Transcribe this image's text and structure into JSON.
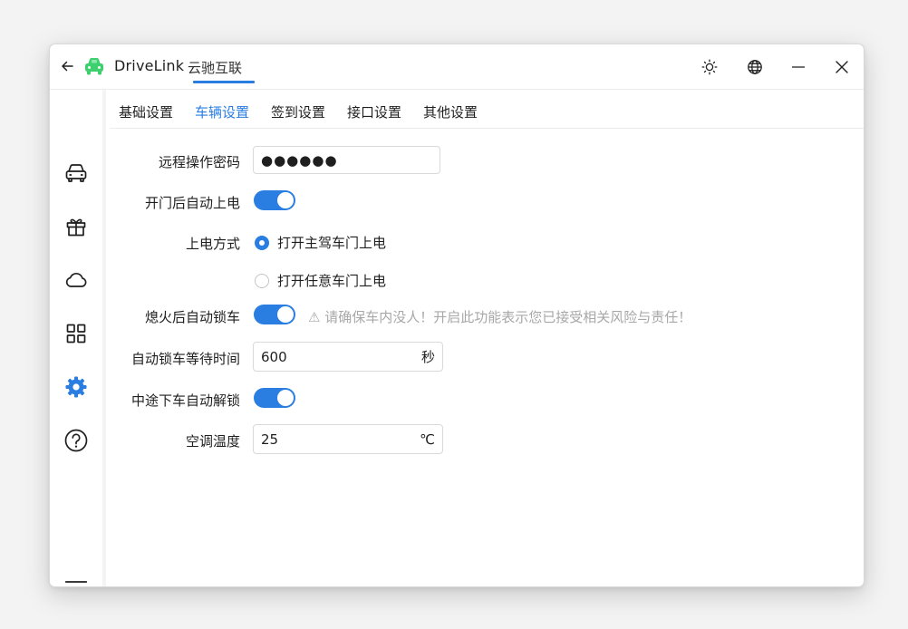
{
  "app": {
    "name": "DriveLink",
    "subname": "云驰互联"
  },
  "tabs": [
    {
      "label": "基础设置",
      "active": false
    },
    {
      "label": "车辆设置",
      "active": true
    },
    {
      "label": "签到设置",
      "active": false
    },
    {
      "label": "接口设置",
      "active": false
    },
    {
      "label": "其他设置",
      "active": false
    }
  ],
  "sidebar": {
    "items": [
      {
        "icon": "car-icon"
      },
      {
        "icon": "gift-icon"
      },
      {
        "icon": "cloud-icon"
      },
      {
        "icon": "grid-icon"
      },
      {
        "icon": "gear-icon",
        "active": true
      },
      {
        "icon": "help-icon"
      }
    ],
    "bottom_icon": "menu-collapse-icon"
  },
  "colors": {
    "accent": "#2a7de1",
    "logo": "#3ecf6e",
    "warning_text": "#a8a8a8"
  },
  "form": {
    "remote_password": {
      "label": "远程操作密码",
      "value": "●●●●●●"
    },
    "power_on_after_open": {
      "label": "开门后自动上电",
      "enabled": true
    },
    "power_mode": {
      "label": "上电方式",
      "options": [
        "打开主驾车门上电",
        "打开任意车门上电"
      ],
      "selected": 0
    },
    "auto_lock_after_off": {
      "label": "熄火后自动锁车",
      "enabled": true,
      "warning": "⚠ 请确保车内没人！开启此功能表示您已接受相关风险与责任！"
    },
    "auto_lock_wait": {
      "label": "自动锁车等待时间",
      "value": "600",
      "unit": "秒"
    },
    "auto_unlock_midway": {
      "label": "中途下车自动解锁",
      "enabled": true
    },
    "ac_temperature": {
      "label": "空调温度",
      "value": "25",
      "unit": "℃"
    }
  }
}
